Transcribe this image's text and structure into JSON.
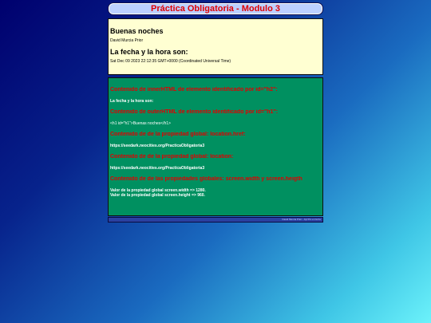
{
  "page": {
    "title": "Práctica Obligatoria - Modulo 3"
  },
  "greeting": {
    "heading": "Buenas noches",
    "author": "David Murcia Prior",
    "date_heading": "La fecha y la hora son:",
    "date_value": "Sat Dec 09 2023 22:12:35 GMT+0000 (Coordinated Universal Time)"
  },
  "results": {
    "inner_html_heading": "Contenido de innerHTML de elemento identificado por id=\"h2\":",
    "inner_html_value": "La fecha y la hora son:",
    "outer_html_heading": "Contenido de outerHTML de elemento identificado por id=\"h1\":",
    "outer_html_value": "<h1 id=\"h1\">Buenas noches</h1>",
    "href_heading": "Contenido de de la propiedad global: location.href:",
    "href_value": "https://seedark.neocities.org/PracticaObligatoria3",
    "location_heading": "Contenido de de la propiedad global: location:",
    "location_value": "https://seedark.neocities.org/PracticaObligatoria3",
    "screen_heading": "Contenido de de las propiedades globales: screen.width y screen.heigth",
    "screen_width": "Valor de la propiedad global screen.width => 1280.",
    "screen_height": "Valor de la propiedad global screen.height => 960."
  },
  "footer": {
    "text": "David Murcia Prior - Ayl Pro en la Fe"
  }
}
